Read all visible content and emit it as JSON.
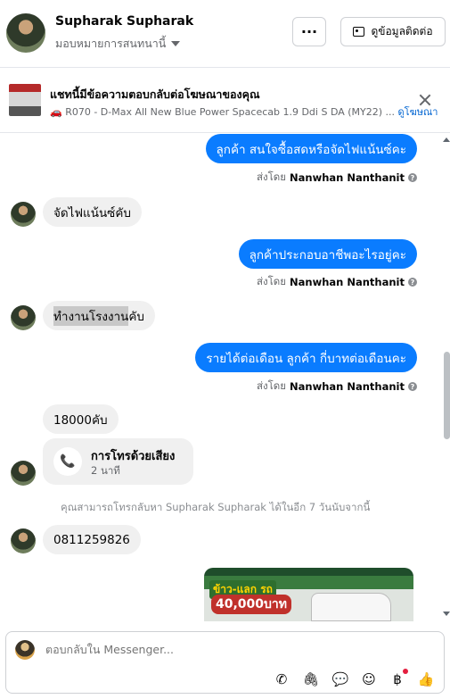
{
  "header": {
    "name": "Supharak Supharak",
    "assign_label": "มอบหมายการสนทนานี้",
    "more_label": "···",
    "contact_label": "ดูข้อมูลติดต่อ"
  },
  "adbar": {
    "title": "แชทนี้มีข้อความตอบกลับต่อโฆษณาของคุณ",
    "subtitle": "🚗 R070 - D-Max All New Blue Power Spacecab 1.9 Ddi S DA (MY22) ...",
    "link": "ดูโฆษณา"
  },
  "messages": {
    "m1": "ลูกค้า สนใจซื้อสดหรือจัดไฟแน้นซ์คะ",
    "m2": "จัดไฟแน้นซ์คับ",
    "m3": "ลูกค้าประกอบอาชีพอะไรอยู่คะ",
    "m4a": "ทำงานโรงงาน",
    "m4b": "คับ",
    "m5": "รายได้ต่อเดือน  ลูกค้า กี่บาทต่อเดือนคะ",
    "m6": "18000คับ",
    "m7": "0811259826"
  },
  "sentby": {
    "prefix": "ส่งโดย",
    "name": "Nanwhan Nanthanit"
  },
  "call": {
    "title": "การโทรด้วยเสียง",
    "time": "2 นาที"
  },
  "notice": "คุณสามารถโทรกลับหา Supharak Supharak ได้ในอีก 7 วันนับจากนี้",
  "ad_image": {
    "promo": "ข้าว-แลก รถ",
    "price": "40,000บาท"
  },
  "composer": {
    "placeholder": "ตอบกลับใน Messenger..."
  }
}
